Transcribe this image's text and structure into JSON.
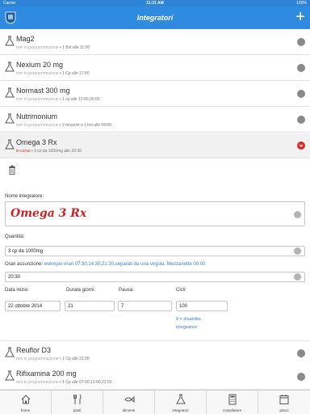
{
  "status_bar": {
    "carrier": "Carrier",
    "time": "11:31 AM",
    "battery": "100%"
  },
  "nav": {
    "title": "Integratori",
    "add_icon": "plus-icon",
    "logo_icon": "shield-logo-icon"
  },
  "colors": {
    "nav": "#2f8be0",
    "accent_red": "#e02626",
    "text_red": "#c8242a",
    "link_blue": "#3b7fd1"
  },
  "items": [
    {
      "name": "Mag2",
      "status": "non in programmazione",
      "detail": " • 1 Bst alle 11:00"
    },
    {
      "name": "Nexium 20 mg",
      "status": "non in programmazione",
      "detail": " • 1 Cp alle 17:00"
    },
    {
      "name": "Normast 300 mg",
      "status": "non in programmazione",
      "detail": " • 1 cp alle 12:00,20:00"
    },
    {
      "name": "Nutrimonium",
      "status": "non in programmazione",
      "detail": " • 2 misurini o 1 bst alle 09:00"
    },
    {
      "name": "Omega 3 Rx",
      "status": "in corso",
      "detail": " • 3 cp da 1000mg alle 20:30"
    },
    {
      "name": "Reuflor D3",
      "status": "non in programmazione",
      "detail": " • 1 Cp alle 21:30"
    },
    {
      "name": "Rifixamina 200 mg",
      "status": "non in programmazione",
      "detail": " • 1 Cp alle 07:00,13:00,21:00"
    }
  ],
  "form": {
    "delete_icon": "trash-icon",
    "name_label": "Nome integratore:",
    "name_value": "Omega 3 Rx",
    "quantity_label": "Quantità:",
    "quantity_value": "3 cp da 1000mg",
    "times_label": "Orari assunzione:",
    "times_example": "esempio orari 07:30,14:30,21:30,separati da una virgola. Mezzanotte 00:00",
    "times_value": "20:30",
    "start_label": "Data inizio:",
    "start_value": "22 ottobre 2014",
    "days_label": "Durata giorni:",
    "days_value": "21",
    "pause_label": "Pausa:",
    "pause_value": "7",
    "cycles_label": "Cicli:",
    "cycles_value": "100",
    "cycles_hint_1": "0 = disabilita",
    "cycles_hint_2": "integratore"
  },
  "tabs": [
    {
      "label": "home",
      "icon": "house-icon"
    },
    {
      "label": "pasti",
      "icon": "cutlery-icon"
    },
    {
      "label": "alimenti",
      "icon": "fish-icon"
    },
    {
      "label": "integratori",
      "icon": "flask-icon"
    },
    {
      "label": "compilatore",
      "icon": "calculator-icon"
    },
    {
      "label": "piano",
      "icon": "calendar-icon"
    }
  ]
}
